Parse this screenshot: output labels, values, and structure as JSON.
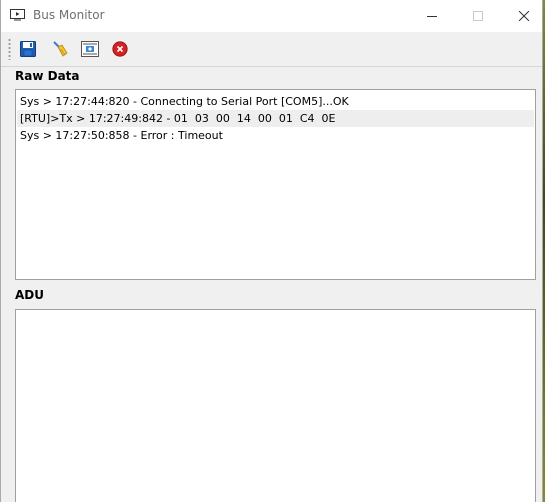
{
  "window": {
    "title": "Bus Monitor"
  },
  "toolbar": {
    "items": [
      {
        "name": "save",
        "icon": "floppy-disk-icon"
      },
      {
        "name": "clear",
        "icon": "broom-icon"
      },
      {
        "name": "settings",
        "icon": "monitor-settings-icon"
      },
      {
        "name": "stop",
        "icon": "red-close-circle-icon"
      }
    ]
  },
  "raw_data": {
    "label": "Raw Data",
    "rows": [
      {
        "text": "Sys > 17:27:44:820 - Connecting to Serial Port [COM5]...OK"
      },
      {
        "text": "[RTU]>Tx > 17:27:49:842 - 01  03  00  14  00  01  C4  0E"
      },
      {
        "text": "Sys > 17:27:50:858 - Error : Timeout"
      }
    ]
  },
  "adu": {
    "label": "ADU"
  },
  "colors": {
    "window_bg": "#f0f0f0",
    "titlebar_bg": "#ffffff",
    "alt_row": "#eeeeee",
    "stop_red": "#d42121",
    "save_blue": "#1e5fb4"
  }
}
